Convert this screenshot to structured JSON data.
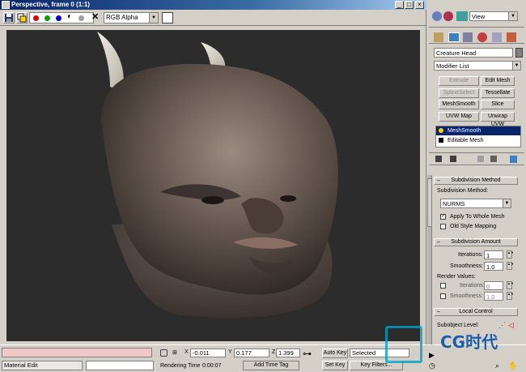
{
  "window": {
    "title": "Perspective, frame 0 (1:1)",
    "min_symbol": "_",
    "max_symbol": "□",
    "close_symbol": "×"
  },
  "toolbar": {
    "channel_value": "RGB Alpha",
    "clear_symbol": "✕",
    "channel_colors": [
      "#e00000",
      "#00a000",
      "#0000d0"
    ],
    "mono_symbol": "◐"
  },
  "viewport": {
    "background": "#2c2c2c",
    "subject": "creature-head-render"
  },
  "command_panel": {
    "view_select": "View",
    "object_name": "Creature Head",
    "object_color": "#808080",
    "modifier_list": "Modifier List",
    "modifier_buttons": [
      "Extrude",
      "Edit Mesh",
      "SplineSelect",
      "Tessellate",
      "MeshSmooth",
      "Slice",
      "UVW Map",
      "Unwrap UVW"
    ],
    "disabled_buttons": [
      "Extrude",
      "SplineSelect"
    ],
    "stack": [
      "MeshSmooth",
      "Editable Mesh"
    ],
    "subdivision": {
      "rollout": "Subdivision Method",
      "method_label": "Subdivision Method:",
      "method_value": "NURMS",
      "apply_whole_mesh": "Apply To Whole Mesh",
      "apply_whole_mesh_checked": true,
      "old_style": "Old Style Mapping",
      "old_style_checked": false
    },
    "amount": {
      "rollout": "Subdivision Amount",
      "iterations_label": "Iterations:",
      "iterations": "1",
      "smoothness_label": "Smoothness:",
      "smoothness": "1.0",
      "render_label": "Render Values:",
      "render_iterations_label": "Iterations:",
      "render_iterations": "0",
      "render_smoothness_label": "Smoothness:",
      "render_smoothness": "1.0"
    },
    "local": {
      "rollout": "Local Control",
      "subobject_label": "Subobject Level:"
    },
    "minus": "–"
  },
  "status": {
    "material_editor": "Material Edit",
    "x_label": "X",
    "x": "-0.011",
    "y_label": "Y",
    "y": "0.177",
    "z_label": "Z",
    "z": "1.399",
    "auto_key": "Auto Key",
    "set_key": "Set Key",
    "key_mode": "Selected",
    "key_filters": "Key Filters...",
    "rendering_time_label": "Rendering Time",
    "rendering_time": "0:00:07",
    "add_time_tag": "Add Time Tag",
    "watermark": "CG时代"
  }
}
